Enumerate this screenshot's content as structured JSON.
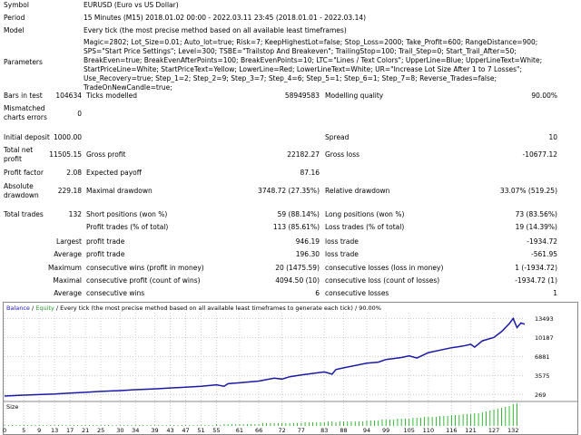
{
  "header": {
    "symbol_label": "Symbol",
    "symbol_value": "EURUSD (Euro vs US Dollar)",
    "period_label": "Period",
    "period_value": "15 Minutes (M15) 2018.01.02 00:00 - 2022.03.11 23:45 (2018.01.01 - 2022.03.14)",
    "model_label": "Model",
    "model_value": "Every tick (the most precise method based on all available least timeframes)",
    "parameters_label": "Parameters",
    "parameters_value": "Magic=2802; Lot_Size=0.01; Auto_lot=true; Risk=7; KeepHighestLot=false; Stop_Loss=2000; Take_Profit=600; RangeDistance=900; SPS=\"Start Price Settings\"; Level=300; TSBE=\"Trailstop And Breakeven\"; TrailingStop=100; Trail_Step=0; Start_Trail_After=50; BreakEven=true; BreakEvenAfterPoints=100; BreakEvenPoints=10; LTC=\"Lines / Text Colors\"; UpperLine=Blue; UpperLineText=White; StartPriceLine=White; StartPriceText=Yellow; LowerLine=Red; LowerLineText=White; UR=\"Increase Lot Size After 1 to 7 Losses\"; Use_Recovery=true; Step_1=2; Step_2=9; Step_3=7; Step_4=6; Step_5=1; Step_6=1; Step_7=8; Reverse_Trades=false; TradeOnNewCandle=true;"
  },
  "stats": {
    "bars_label": "Bars in test",
    "bars_value": "104634",
    "ticks_label": "Ticks modelled",
    "ticks_value": "58949583",
    "quality_label": "Modelling quality",
    "quality_value": "90.00%",
    "mismatched_label_1": "Mismatched",
    "mismatched_label_2": "charts errors",
    "mismatched_value": "0",
    "deposit_label": "Initial deposit",
    "deposit_value": "1000.00",
    "spread_label": "Spread",
    "spread_value": "10",
    "netprofit_label_1": "Total net",
    "netprofit_label_2": "profit",
    "netprofit_value": "11505.15",
    "grossprofit_label": "Gross profit",
    "grossprofit_value": "22182.27",
    "grossloss_label": "Gross loss",
    "grossloss_value": "-10677.12",
    "pf_label": "Profit factor",
    "pf_value": "2.08",
    "payoff_label": "Expected payoff",
    "payoff_value": "87.16",
    "absdd_label_1": "Absolute",
    "absdd_label_2": "drawdown",
    "absdd_value": "229.18",
    "maxdd_label": "Maximal drawdown",
    "maxdd_value": "3748.72 (27.35%)",
    "reldd_label": "Relative drawdown",
    "reldd_value": "33.07% (519.25)",
    "trades_label": "Total trades",
    "trades_value": "132",
    "short_label": "Short positions (won %)",
    "short_value": "59 (88.14%)",
    "long_label": "Long positions (won %)",
    "long_value": "73 (83.56%)",
    "ptrades_label": "Profit trades (% of total)",
    "ptrades_value": "113 (85.61%)",
    "ltrades_label": "Loss trades (% of total)",
    "ltrades_value": "19 (14.39%)",
    "largest_label": "Largest",
    "largest_profit_label": "profit trade",
    "largest_profit_value": "946.19",
    "largest_loss_label": "loss trade",
    "largest_loss_value": "-1934.72",
    "average_label": "Average",
    "average_profit_label": "profit trade",
    "average_profit_value": "196.30",
    "average_loss_label": "loss trade",
    "average_loss_value": "-561.95",
    "maximum_label": "Maximum",
    "max_cw_label": "consecutive wins (profit in money)",
    "max_cw_value": "20 (1475.59)",
    "max_cl_label": "consecutive losses (loss in money)",
    "max_cl_value": "1 (-1934.72)",
    "maximal_label": "Maximal",
    "maximal_cp_label": "consecutive profit (count of wins)",
    "maximal_cp_value": "4094.50 (10)",
    "maximal_cl_label": "consecutive loss (count of losses)",
    "maximal_cl_value": "-1934.72 (1)",
    "avg2_label": "Average",
    "avg_cw_label": "consecutive wins",
    "avg_cw_value": "6",
    "avg_cl_label": "consecutive losses",
    "avg_cl_value": "1"
  },
  "chart_data": {
    "type": "line",
    "legend": {
      "balance": "Balance",
      "sep": " / ",
      "equity": "Equity",
      "rest": " / Every tick (the most precise method based on all available least timeframes to generate each tick) / 90.00%"
    },
    "colors": {
      "balance": "#1a1aa6",
      "equity": "#00aa00",
      "legend_balance": "#2020c0",
      "legend_equity": "#2a9a2a"
    },
    "ylim": [
      0,
      14500
    ],
    "y_ticks": [
      269,
      3575,
      6881,
      10187,
      13493
    ],
    "x_ticks": [
      0,
      5,
      9,
      13,
      17,
      21,
      25,
      30,
      34,
      39,
      43,
      47,
      51,
      55,
      61,
      66,
      72,
      77,
      83,
      88,
      94,
      99,
      105,
      110,
      116,
      121,
      127,
      132
    ],
    "size_label": "Size",
    "series": [
      {
        "name": "Balance",
        "values": [
          [
            0,
            0
          ],
          [
            5,
            150
          ],
          [
            9,
            250
          ],
          [
            13,
            350
          ],
          [
            17,
            500
          ],
          [
            21,
            650
          ],
          [
            25,
            800
          ],
          [
            30,
            950
          ],
          [
            34,
            1100
          ],
          [
            39,
            1250
          ],
          [
            43,
            1400
          ],
          [
            47,
            1550
          ],
          [
            51,
            1700
          ],
          [
            55,
            1950
          ],
          [
            57,
            1700
          ],
          [
            58,
            2150
          ],
          [
            61,
            2300
          ],
          [
            66,
            2600
          ],
          [
            70,
            3100
          ],
          [
            72,
            2950
          ],
          [
            74,
            3350
          ],
          [
            77,
            3650
          ],
          [
            83,
            4200
          ],
          [
            85,
            3800
          ],
          [
            86,
            4600
          ],
          [
            88,
            4900
          ],
          [
            94,
            5700
          ],
          [
            97,
            5900
          ],
          [
            99,
            6350
          ],
          [
            103,
            6700
          ],
          [
            105,
            7000
          ],
          [
            107,
            6600
          ],
          [
            110,
            7550
          ],
          [
            116,
            8400
          ],
          [
            119,
            8700
          ],
          [
            121,
            9000
          ],
          [
            122,
            8500
          ],
          [
            124,
            9600
          ],
          [
            127,
            10200
          ],
          [
            129,
            11200
          ],
          [
            131,
            12600
          ],
          [
            132,
            13493
          ],
          [
            133,
            11900
          ],
          [
            134,
            12700
          ],
          [
            135,
            12500
          ]
        ]
      }
    ],
    "size_series": {
      "name": "Size",
      "values": [
        0.01,
        0.01,
        0.01,
        0.01,
        0.01,
        0.01,
        0.01,
        0.01,
        0.01,
        0.01,
        0.01,
        0.01,
        0.01,
        0.01,
        0.01,
        0.01,
        0.01,
        0.01,
        0.01,
        0.01,
        0.01,
        0.01,
        0.01,
        0.01,
        0.01,
        0.01,
        0.01,
        0.01,
        0.01,
        0.01,
        0.01,
        0.01,
        0.01,
        0.01,
        0.01,
        0.01,
        0.01,
        0.01,
        0.01,
        0.01,
        0.01,
        0.01,
        0.01,
        0.01,
        0.01,
        0.01,
        0.01,
        0.01,
        0.01,
        0.01,
        0.01,
        0.01,
        0.01,
        0.01,
        0.01,
        0.02,
        0.01,
        0.02,
        0.02,
        0.02,
        0.02,
        0.02,
        0.02,
        0.02,
        0.02,
        0.02,
        0.02,
        0.03,
        0.03,
        0.03,
        0.03,
        0.03,
        0.03,
        0.03,
        0.03,
        0.03,
        0.03,
        0.03,
        0.04,
        0.04,
        0.04,
        0.04,
        0.04,
        0.04,
        0.05,
        0.05,
        0.04,
        0.05,
        0.05,
        0.05,
        0.05,
        0.05,
        0.05,
        0.05,
        0.06,
        0.06,
        0.06,
        0.06,
        0.07,
        0.07,
        0.07,
        0.07,
        0.08,
        0.08,
        0.08,
        0.08,
        0.09,
        0.09,
        0.09,
        0.1,
        0.1,
        0.1,
        0.1,
        0.11,
        0.11,
        0.11,
        0.12,
        0.12,
        0.12,
        0.13,
        0.13,
        0.13,
        0.14,
        0.14,
        0.15,
        0.16,
        0.17,
        0.18,
        0.19,
        0.2,
        0.21,
        0.22,
        0.24,
        0.25
      ]
    }
  }
}
